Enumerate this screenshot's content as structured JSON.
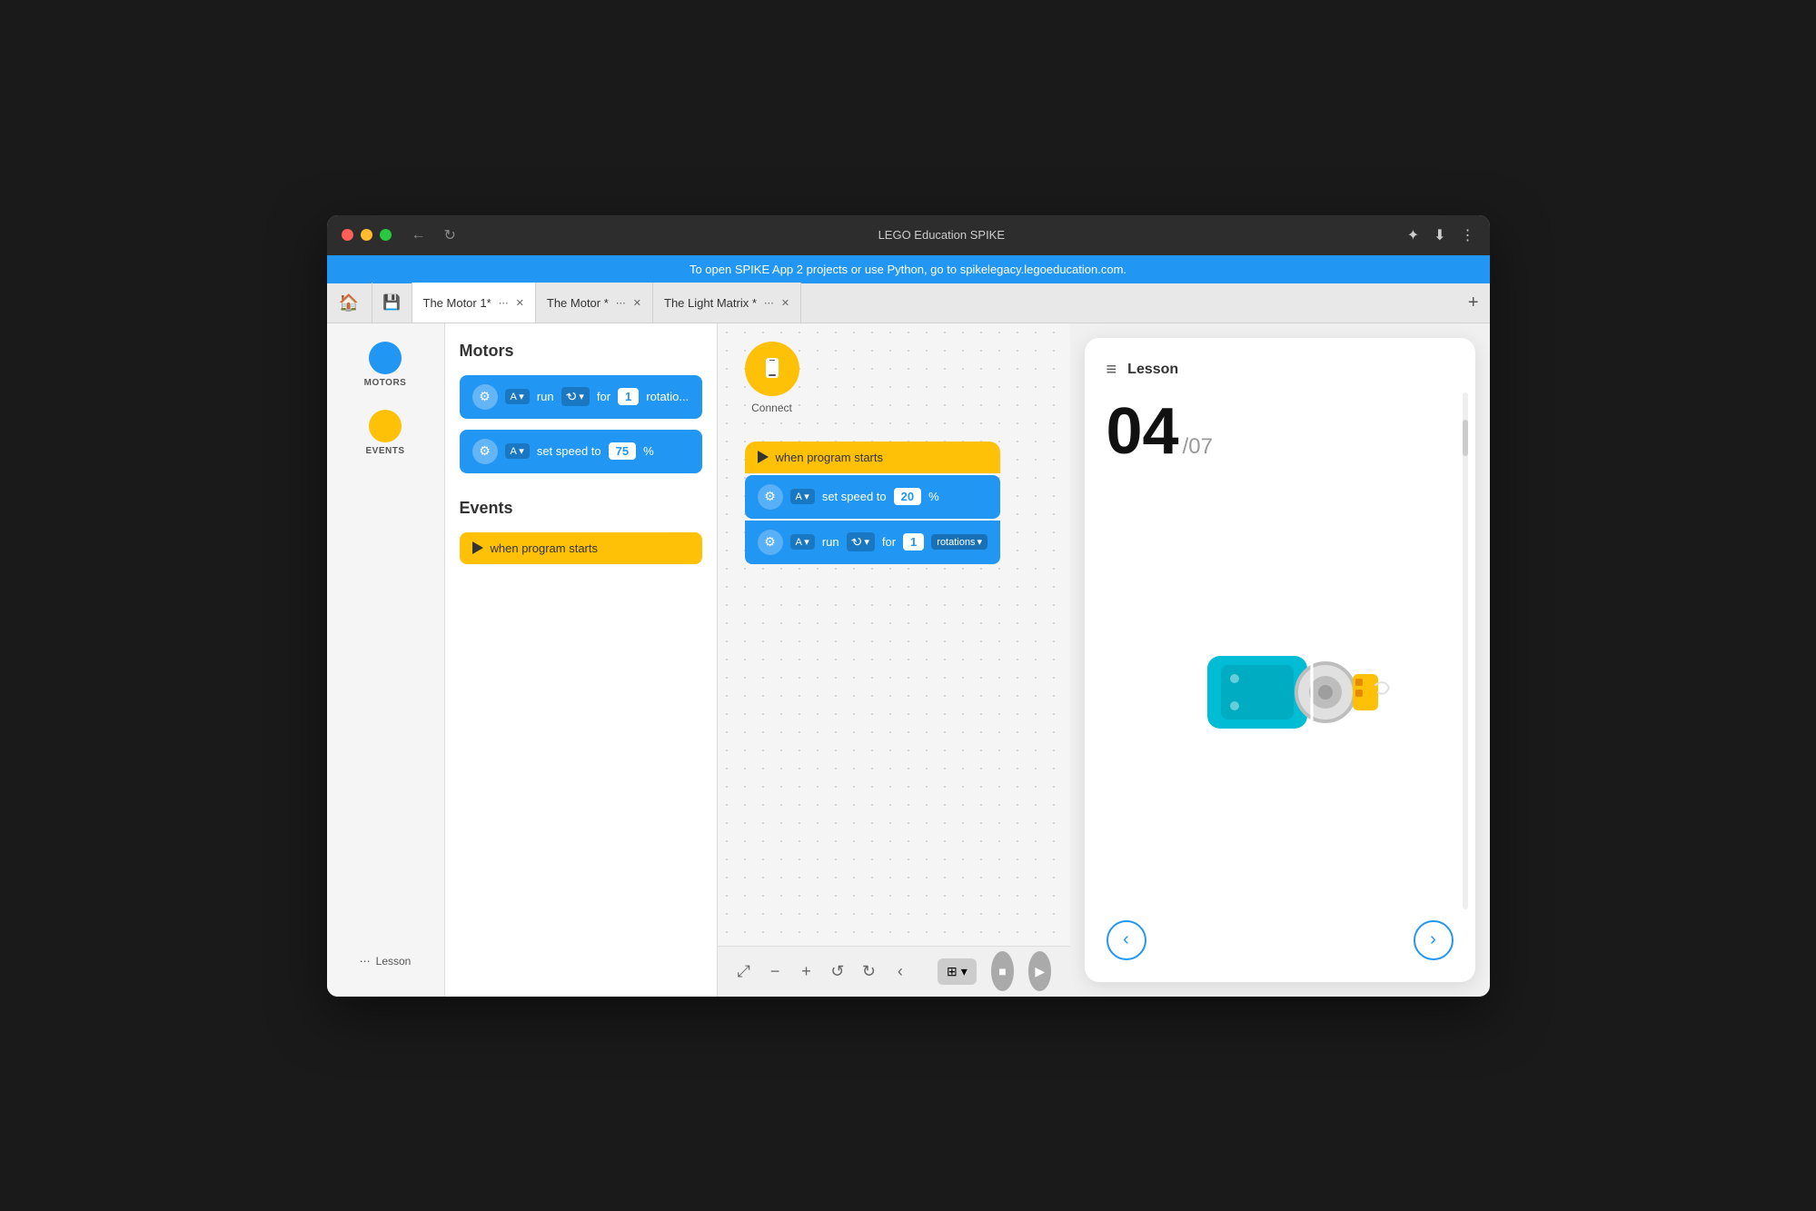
{
  "window": {
    "title": "LEGO Education SPIKE"
  },
  "banner": {
    "text": "To open SPIKE App 2 projects or use Python, go to spikelegacy.legoeducation.com."
  },
  "tabs": [
    {
      "label": "The Motor 1*",
      "active": true
    },
    {
      "label": "The Motor *",
      "active": false
    },
    {
      "label": "The Light Matrix *",
      "active": false
    }
  ],
  "sidebar": {
    "items": [
      {
        "label": "MOTORS",
        "color": "#2196f3"
      },
      {
        "label": "EVENTS",
        "color": "#ffc107"
      }
    ],
    "lesson_label": "Lesson"
  },
  "blocks_panel": {
    "motors_title": "Motors",
    "events_title": "Events",
    "motor_block1": {
      "motor": "A",
      "action": "run",
      "duration": "1",
      "unit": "rotatio..."
    },
    "motor_block2": {
      "motor": "A",
      "action": "set speed to",
      "value": "75",
      "unit": "%"
    },
    "event_block": {
      "label": "when program starts"
    }
  },
  "canvas": {
    "connect_label": "Connect",
    "program": {
      "trigger": "when program starts",
      "block1_motor": "A",
      "block1_action": "set speed to",
      "block1_value": "20",
      "block1_unit": "%",
      "block2_motor": "A",
      "block2_action": "run",
      "block2_duration": "1",
      "block2_unit": "rotations"
    }
  },
  "toolbar": {
    "fit_icon": "⤢",
    "zoom_out_icon": "−",
    "zoom_in_icon": "+",
    "undo_icon": "↺",
    "redo_icon": "↻",
    "back_icon": "‹",
    "grid_icon": "⊞",
    "grid_arrow": "▾",
    "stop_icon": "■",
    "play_icon": "▶"
  },
  "lesson_panel": {
    "title": "Lesson",
    "number": "04",
    "total": "/07",
    "prev_icon": "‹",
    "next_icon": "›"
  }
}
